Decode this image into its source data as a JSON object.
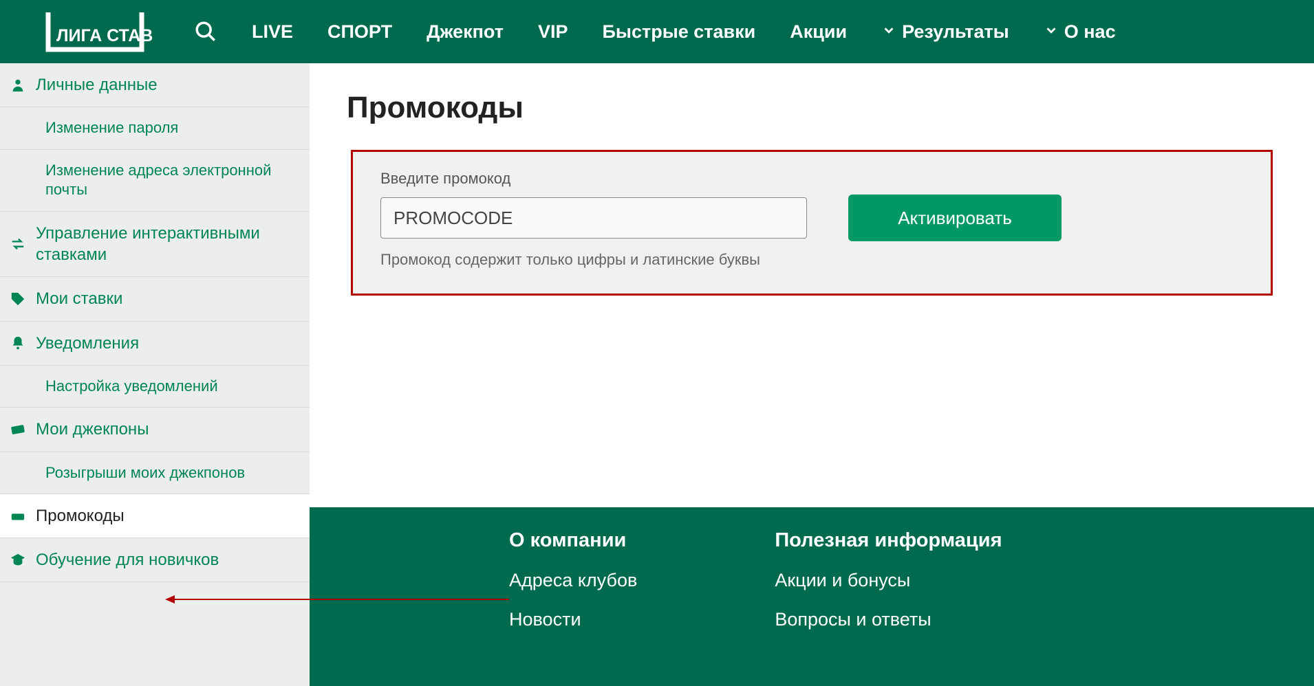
{
  "header": {
    "logo_text": "ЛИГА СТАВОК",
    "nav": [
      {
        "label": "LIVE"
      },
      {
        "label": "СПОРТ"
      },
      {
        "label": "Джекпот"
      },
      {
        "label": "VIP"
      },
      {
        "label": "Быстрые ставки"
      },
      {
        "label": "Акции"
      },
      {
        "label": "Результаты",
        "chevron": true
      },
      {
        "label": "О нас",
        "chevron": true
      }
    ]
  },
  "sidebar": {
    "items": [
      {
        "icon": "person",
        "label": "Личные данные"
      },
      {
        "icon": "",
        "label": "Изменение пароля",
        "sub": true
      },
      {
        "icon": "",
        "label": "Изменение адреса электронной почты",
        "sub": true
      },
      {
        "icon": "transfer",
        "label": "Управление интерактивными ставками"
      },
      {
        "icon": "tags",
        "label": "Мои ставки"
      },
      {
        "icon": "bell",
        "label": "Уведомления"
      },
      {
        "icon": "",
        "label": "Настройка уведомлений",
        "sub": true
      },
      {
        "icon": "card",
        "label": "Мои джекпоны"
      },
      {
        "icon": "",
        "label": "Розыгрыши моих джекпонов",
        "sub": true
      },
      {
        "icon": "ticket",
        "label": "Промокоды",
        "active": true
      },
      {
        "icon": "grad-cap",
        "label": "Обучение для новичков"
      }
    ]
  },
  "main": {
    "title": "Промокоды",
    "promo_label": "Введите промокод",
    "promo_value": "PROMOCODE",
    "activate_label": "Активировать",
    "hint": "Промокод содержит только цифры и латинские буквы"
  },
  "footer": {
    "col1_head": "О компании",
    "col1_links": [
      "Адреса клубов",
      "Новости"
    ],
    "col2_head": "Полезная информация",
    "col2_links": [
      "Акции и бонусы",
      "Вопросы и ответы"
    ]
  }
}
